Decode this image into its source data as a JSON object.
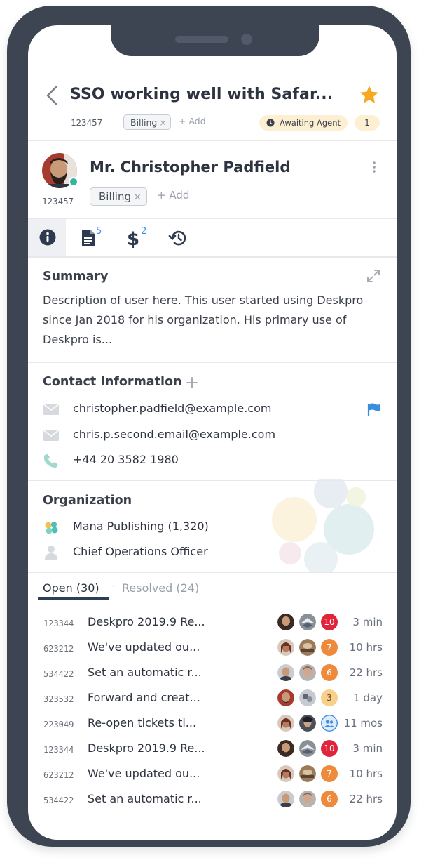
{
  "header": {
    "title": "SSO working well with Safar...",
    "ticket_id": "123457",
    "tag": "Billing",
    "tag_remove": "×",
    "add_label": "+ Add",
    "status": "Awaiting Agent",
    "status_count": "1",
    "colors": {
      "star": "#f7a823",
      "status_bg": "#fdf0d2"
    }
  },
  "profile": {
    "name": "Mr. Christopher Padfield",
    "id": "123457",
    "tag": "Billing",
    "tag_remove": "×",
    "add_label": "+ Add"
  },
  "tabs": [
    {
      "icon": "info-icon",
      "badge": ""
    },
    {
      "icon": "document-icon",
      "badge": "5"
    },
    {
      "icon": "dollar-icon",
      "badge": "2"
    },
    {
      "icon": "history-icon",
      "badge": ""
    }
  ],
  "summary": {
    "title": "Summary",
    "text": "Description of user here. This user started using Deskpro since Jan 2018 for his organization. His primary use of Deskpro is..."
  },
  "contact": {
    "title": "Contact Information",
    "emails": [
      "christopher.padfield@example.com",
      "chris.p.second.email@example.com"
    ],
    "phone": "+44 20 3582 1980"
  },
  "organization": {
    "title": "Organization",
    "name": "Mana Publishing (1,320)",
    "role": "Chief Operations Officer"
  },
  "ticket_tabs": {
    "open": "Open (30)",
    "separator": "·",
    "resolved": "Resolved (24)"
  },
  "tickets": [
    {
      "id": "123344",
      "title": "Deskpro 2019.9 Re...",
      "count": "10",
      "badge_color": "#e0243a",
      "time": "3 min"
    },
    {
      "id": "623212",
      "title": "We've updated ou...",
      "count": "7",
      "badge_color": "#ee8a3b",
      "time": "10 hrs"
    },
    {
      "id": "534422",
      "title": "Set an automatic r...",
      "count": "6",
      "badge_color": "#ee8a3b",
      "time": "22 hrs"
    },
    {
      "id": "323532",
      "title": "Forward and creat...",
      "count": "3",
      "badge_color": "#f9d08a",
      "time": "1 day"
    },
    {
      "id": "223049",
      "title": "Re-open tickets ti...",
      "count": "",
      "badge_color": "#ddeaf8",
      "time": "11 mos"
    },
    {
      "id": "123344",
      "title": "Deskpro 2019.9 Re...",
      "count": "10",
      "badge_color": "#e0243a",
      "time": "3 min"
    },
    {
      "id": "623212",
      "title": "We've updated ou...",
      "count": "7",
      "badge_color": "#ee8a3b",
      "time": "10 hrs"
    },
    {
      "id": "534422",
      "title": "Set an automatic r...",
      "count": "6",
      "badge_color": "#ee8a3b",
      "time": "22 hrs"
    }
  ]
}
